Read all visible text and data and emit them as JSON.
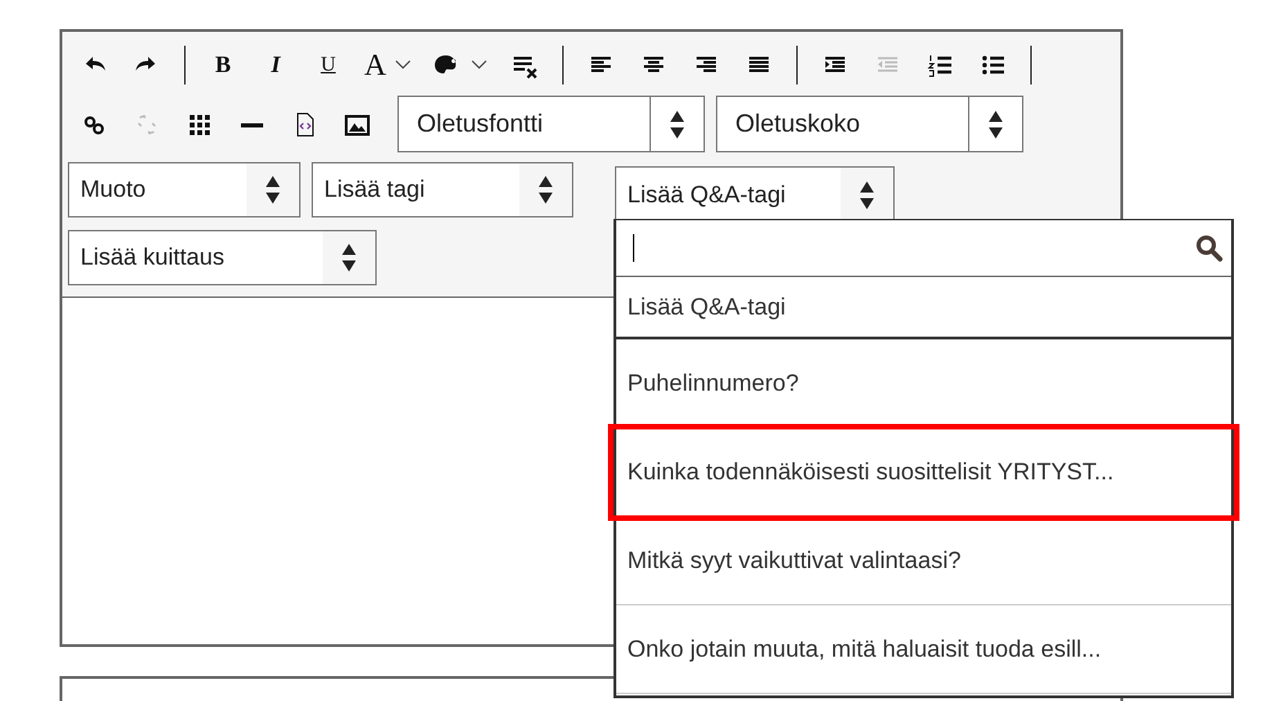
{
  "toolbar": {
    "row_1": [
      {
        "kind": "undo",
        "disabled": false
      },
      {
        "kind": "redo",
        "disabled": false
      },
      {
        "kind": "separator"
      },
      {
        "kind": "bold",
        "label": "B",
        "disabled": false
      },
      {
        "kind": "italic",
        "label": "I",
        "disabled": false
      },
      {
        "kind": "underline",
        "label": "U",
        "disabled": false
      },
      {
        "kind": "text-color",
        "label": "A",
        "disabled": false
      },
      {
        "kind": "background-color",
        "disabled": false
      },
      {
        "kind": "clear-format",
        "disabled": false
      },
      {
        "kind": "separator"
      },
      {
        "kind": "align-left",
        "disabled": false
      },
      {
        "kind": "align-center",
        "disabled": false
      },
      {
        "kind": "align-right",
        "disabled": false
      },
      {
        "kind": "justify",
        "disabled": false
      },
      {
        "kind": "separator"
      },
      {
        "kind": "indent",
        "disabled": false
      },
      {
        "kind": "outdent",
        "disabled": true
      },
      {
        "kind": "numbered-list",
        "disabled": false
      },
      {
        "kind": "bullet-list",
        "disabled": false
      },
      {
        "kind": "separator"
      }
    ],
    "row_2": [
      {
        "kind": "link",
        "disabled": false
      },
      {
        "kind": "unlink",
        "disabled": true
      },
      {
        "kind": "table",
        "disabled": false
      },
      {
        "kind": "horizontal-rule",
        "disabled": false
      },
      {
        "kind": "source",
        "disabled": false
      },
      {
        "kind": "image",
        "disabled": false
      }
    ],
    "font_select": {
      "value": "Oletusfontti"
    },
    "size_select": {
      "value": "Oletuskoko"
    },
    "format_select": {
      "value": "Muoto"
    },
    "tag_select": {
      "value": "Lisää tagi"
    },
    "qa_tag_select": {
      "value": "Lisää Q&A-tagi",
      "open": true
    },
    "acknowledgement_select": {
      "value": "Lisää kuittaus"
    }
  },
  "dropdown": {
    "items": [
      {
        "label": "Lisää Q&A-tagi",
        "kind": "placeholder",
        "highlighted": false
      },
      {
        "label": "Puhelinnumero?",
        "kind": "option",
        "highlighted": false
      },
      {
        "label": "Kuinka todennäköisesti suosittelisit YRITYST...",
        "kind": "option",
        "highlighted": true
      },
      {
        "label": "Mitkä syyt vaikuttivat valintaasi?",
        "kind": "option",
        "highlighted": false
      },
      {
        "label": "Onko jotain muuta, mitä haluaisit tuoda esill...",
        "kind": "option",
        "highlighted": false
      }
    ]
  }
}
